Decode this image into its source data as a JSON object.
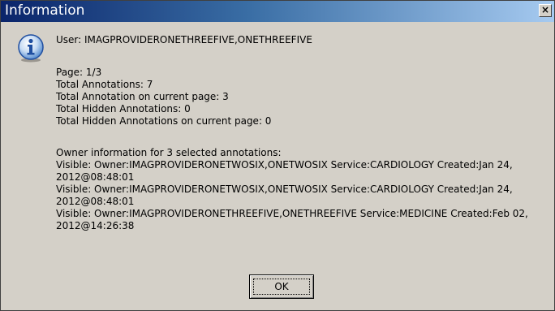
{
  "window": {
    "title": "Information",
    "close_glyph": "×"
  },
  "icon": "info-icon",
  "user_line": "User: IMAGPROVIDERONETHREEFIVE,ONETHREEFIVE",
  "stats": [
    "Page: 1/3",
    "Total Annotations: 7",
    "Total Annotation on current page: 3",
    "Total Hidden Annotations: 0",
    "Total Hidden Annotations on current page: 0"
  ],
  "owner_header": "Owner information for 3 selected annotations:",
  "owner_lines": [
    "Visible: Owner:IMAGPROVIDERONETWOSIX,ONETWOSIX  Service:CARDIOLOGY  Created:Jan 24,",
    "2012@08:48:01",
    "Visible: Owner:IMAGPROVIDERONETWOSIX,ONETWOSIX  Service:CARDIOLOGY  Created:Jan 24,",
    "2012@08:48:01",
    "Visible: Owner:IMAGPROVIDERONETHREEFIVE,ONETHREEFIVE  Service:MEDICINE  Created:Feb 02,",
    "2012@14:26:38"
  ],
  "buttons": {
    "ok_label": "OK"
  }
}
